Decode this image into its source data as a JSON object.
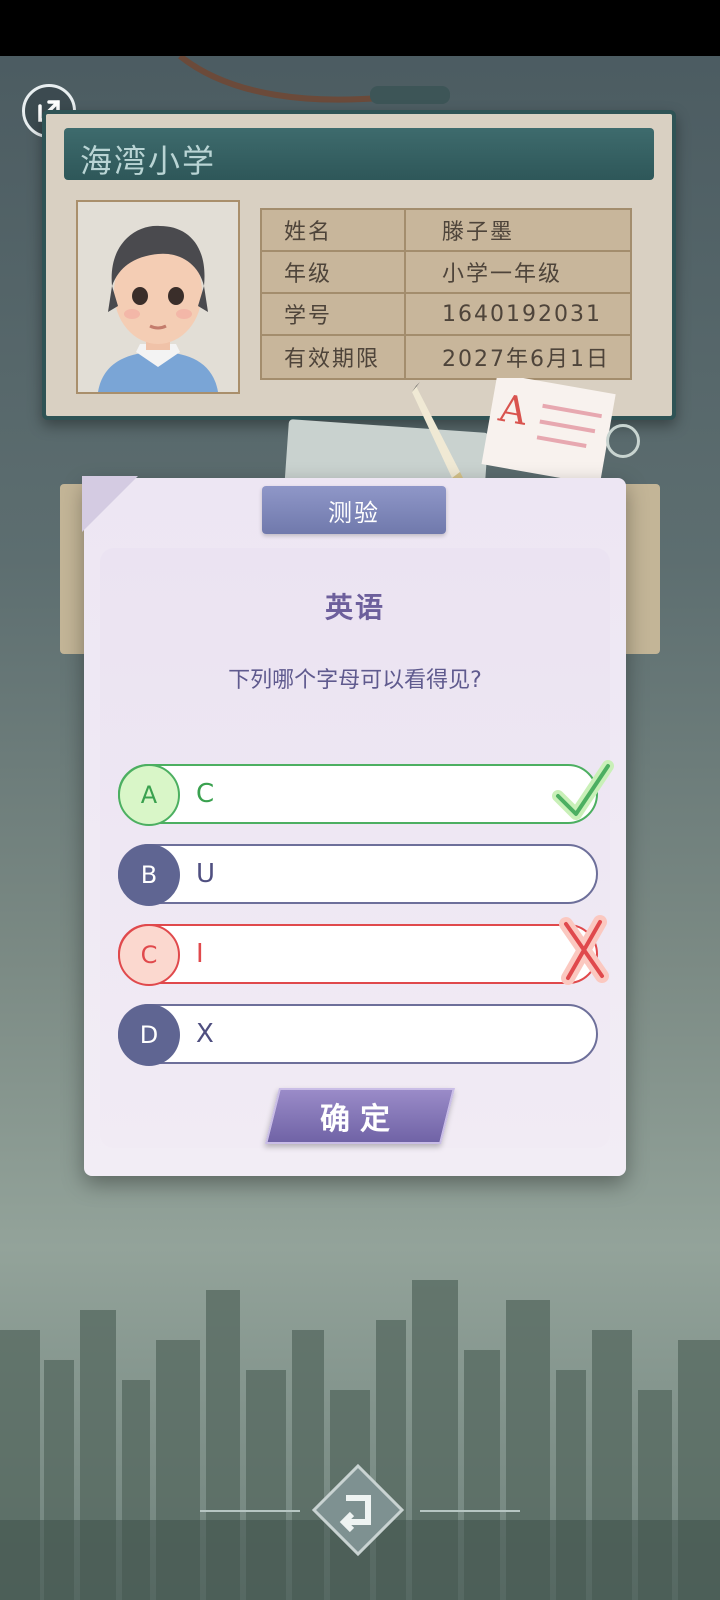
{
  "card": {
    "school": "海湾小学",
    "rows": [
      {
        "label": "姓名",
        "value": "滕子墨"
      },
      {
        "label": "年级",
        "value": "小学一年级"
      },
      {
        "label": "学号",
        "value": "1640192031"
      },
      {
        "label": "有效期限",
        "value": "2027年6月1日"
      }
    ]
  },
  "dialog": {
    "tab": "测验",
    "subject": "英语",
    "question": "下列哪个字母可以看得见?",
    "options": [
      {
        "letter": "A",
        "text": "C",
        "state": "correct"
      },
      {
        "letter": "B",
        "text": "U",
        "state": "normal"
      },
      {
        "letter": "C",
        "text": "I",
        "state": "wrong"
      },
      {
        "letter": "D",
        "text": "X",
        "state": "normal"
      }
    ],
    "confirm": "确定"
  },
  "colors": {
    "correct": "#4caf61",
    "wrong": "#e0494c",
    "accent": "#7079ac"
  },
  "icons": {
    "exit": "exit-arrow-icon",
    "back": "back-arrow-icon",
    "check": "check-icon",
    "cross": "cross-icon"
  }
}
